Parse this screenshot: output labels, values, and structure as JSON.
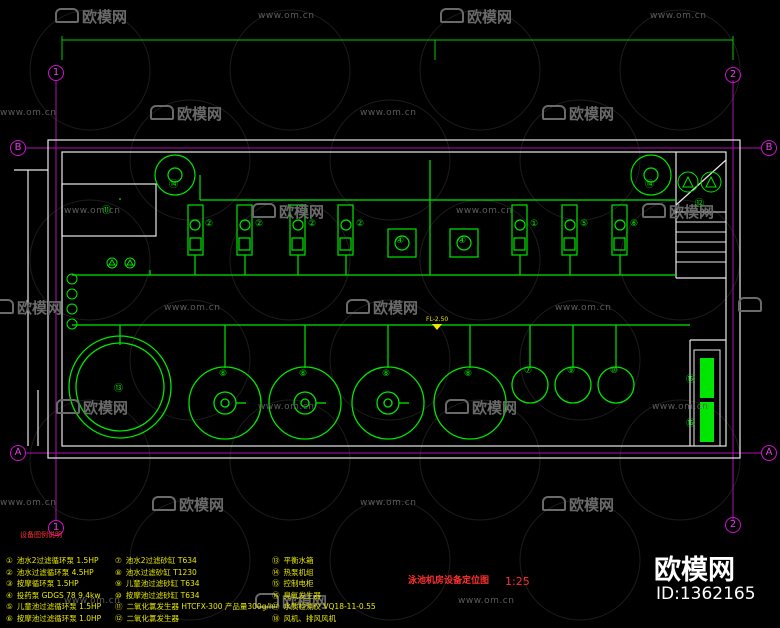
{
  "watermark": {
    "logo_text": "欧模网",
    "url_text": "www.om.cn"
  },
  "axes": {
    "col_1": "1",
    "col_2": "2",
    "row_a": "A",
    "row_b": "B"
  },
  "tags": {
    "pump_1": "①",
    "pump_2": "②",
    "pump_4": "④",
    "pump_5": "⑤",
    "pump_6": "⑥",
    "filter_7": "⑦",
    "filter_8": "⑧",
    "filter_9": "⑨",
    "filter_10": "⑩",
    "heater_14": "⑭",
    "item_11": "⑪",
    "item_12": "⑫",
    "item_15": "⑮",
    "item_16": "⑯",
    "balance_tank": "⑬"
  },
  "elevation_mark": "FL-2.50",
  "legend": {
    "title": "设备图例说明",
    "items": [
      {
        "num": "①",
        "text": "池水2过滤循环泵 1.5HP"
      },
      {
        "num": "②",
        "text": "池水过滤循环泵 4.5HP"
      },
      {
        "num": "③",
        "text": "按摩循环泵 1.5HP"
      },
      {
        "num": "④",
        "text": "投药泵 GDGS 78 9.4kw"
      },
      {
        "num": "⑤",
        "text": "儿童池过滤循环泵 1.5HP"
      },
      {
        "num": "⑥",
        "text": "按摩池过滤循环泵 1.0HP"
      },
      {
        "num": "⑦",
        "text": "池水2过滤砂缸 T634"
      },
      {
        "num": "⑧",
        "text": "池水过滤砂缸 T1230"
      },
      {
        "num": "⑨",
        "text": "儿童池过滤砂缸 T634"
      },
      {
        "num": "⑩",
        "text": "按摩池过滤砂缸 T634"
      },
      {
        "num": "⑪",
        "text": "二氧化氯发生器 HTCFX-300 产品量300g/h"
      },
      {
        "num": "⑫",
        "text": "二氧化氯发生器"
      },
      {
        "num": "⑬",
        "text": "平衡水箱"
      },
      {
        "num": "⑭",
        "text": "热泵机组"
      },
      {
        "num": "⑮",
        "text": "控制电柜"
      },
      {
        "num": "⑯",
        "text": "臭氧发生器"
      },
      {
        "num": "⑰",
        "text": "水质检测仪 VQ18-11-0.55"
      },
      {
        "num": "⑱",
        "text": "风机、排风风机"
      }
    ]
  },
  "sheet": {
    "title": "泳池机房设备定位图",
    "scale": "1:25"
  },
  "brand": {
    "name": "欧模网",
    "id": "ID:1362165"
  },
  "colors": {
    "background": "#000000",
    "equipment": "#00e600",
    "walls": "#e8e8e8",
    "axis": "#d010d0",
    "legend_title": "#ff3030",
    "legend_text": "#e8e800"
  }
}
